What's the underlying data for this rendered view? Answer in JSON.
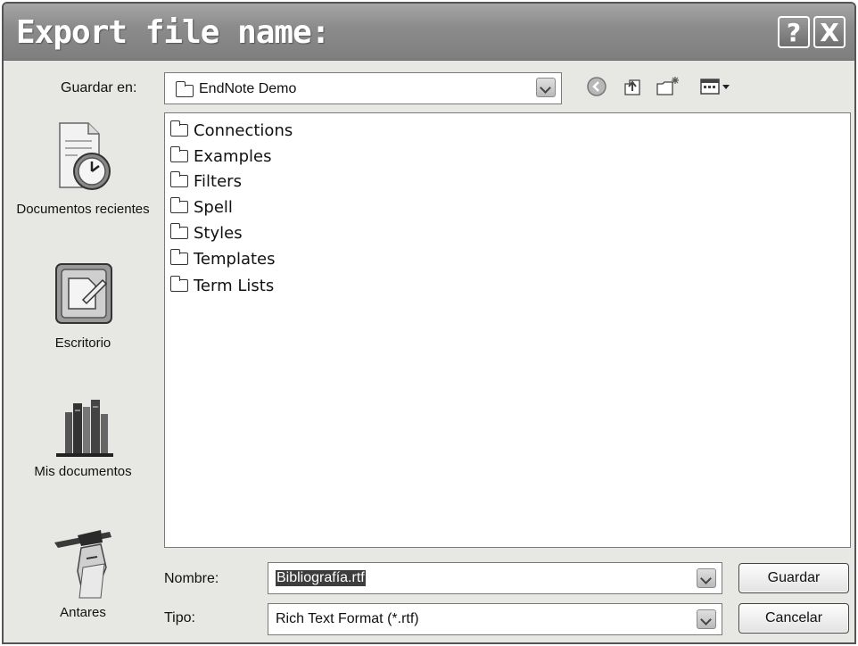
{
  "window": {
    "title": "Export file name:",
    "help_label": "?",
    "close_label": "X"
  },
  "save_in": {
    "label": "Guardar en:",
    "value": "EndNote Demo"
  },
  "places": [
    {
      "label": "Documentos recientes",
      "icon": "recent-documents-icon"
    },
    {
      "label": "Escritorio",
      "icon": "desktop-icon"
    },
    {
      "label": "Mis documentos",
      "icon": "my-documents-icon"
    },
    {
      "label": "Antares",
      "icon": "user-avatar-icon"
    }
  ],
  "files": [
    {
      "name": "Connections"
    },
    {
      "name": "Examples"
    },
    {
      "name": "Filters"
    },
    {
      "name": "Spell"
    },
    {
      "name": "Styles"
    },
    {
      "name": "Templates"
    },
    {
      "name": "Term Lists"
    }
  ],
  "filename": {
    "label": "Nombre:",
    "value": "Bibliografía.rtf"
  },
  "filetype": {
    "label": "Tipo:",
    "value": "Rich Text Format (*.rtf)"
  },
  "buttons": {
    "save": "Guardar",
    "cancel": "Cancelar"
  }
}
